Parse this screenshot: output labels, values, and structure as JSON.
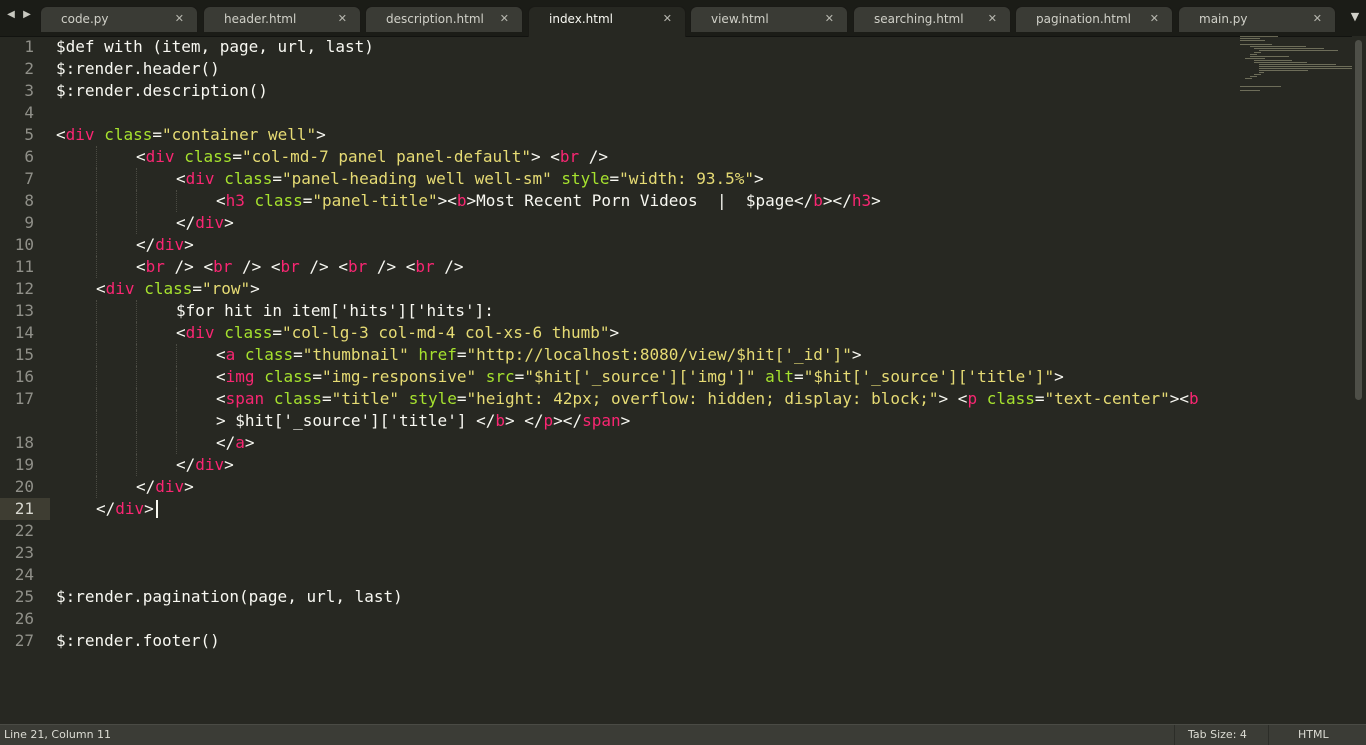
{
  "tabs": [
    {
      "label": "code.py",
      "active": false
    },
    {
      "label": "header.html",
      "active": false
    },
    {
      "label": "description.html",
      "active": false
    },
    {
      "label": "index.html",
      "active": true
    },
    {
      "label": "view.html",
      "active": false
    },
    {
      "label": "searching.html",
      "active": false
    },
    {
      "label": "pagination.html",
      "active": false
    },
    {
      "label": "main.py",
      "active": false
    }
  ],
  "icons": {
    "nav_back": "triangle-left-icon",
    "nav_forward": "triangle-right-icon",
    "tab_close": "close-icon",
    "tab_menu": "chevron-down-icon"
  },
  "editor": {
    "current_line": 21,
    "lines": [
      {
        "num": "1",
        "indent": 0,
        "tokens": [
          [
            "p",
            "$def with (item, page, url, last)"
          ]
        ]
      },
      {
        "num": "2",
        "indent": 0,
        "tokens": [
          [
            "p",
            "$:render.header()"
          ]
        ]
      },
      {
        "num": "3",
        "indent": 0,
        "tokens": [
          [
            "p",
            "$:render.description()"
          ]
        ]
      },
      {
        "num": "4",
        "indent": 0,
        "tokens": []
      },
      {
        "num": "5",
        "indent": 0,
        "tokens": [
          [
            "p",
            "<"
          ],
          [
            "t",
            "div"
          ],
          [
            "p",
            " "
          ],
          [
            "a",
            "class"
          ],
          [
            "p",
            "="
          ],
          [
            "s",
            "\"container well\""
          ],
          [
            "p",
            ">"
          ]
        ]
      },
      {
        "num": "6",
        "indent": 8,
        "tokens": [
          [
            "p",
            "<"
          ],
          [
            "t",
            "div"
          ],
          [
            "p",
            " "
          ],
          [
            "a",
            "class"
          ],
          [
            "p",
            "="
          ],
          [
            "s",
            "\"col-md-7 panel panel-default\""
          ],
          [
            "p",
            "> <"
          ],
          [
            "t",
            "br"
          ],
          [
            "p",
            " />"
          ]
        ]
      },
      {
        "num": "7",
        "indent": 12,
        "tokens": [
          [
            "p",
            "<"
          ],
          [
            "t",
            "div"
          ],
          [
            "p",
            " "
          ],
          [
            "a",
            "class"
          ],
          [
            "p",
            "="
          ],
          [
            "s",
            "\"panel-heading well well-sm\""
          ],
          [
            "p",
            " "
          ],
          [
            "a",
            "style"
          ],
          [
            "p",
            "="
          ],
          [
            "s",
            "\"width: 93.5%\""
          ],
          [
            "p",
            ">"
          ]
        ]
      },
      {
        "num": "8",
        "indent": 16,
        "tokens": [
          [
            "p",
            "<"
          ],
          [
            "t",
            "h3"
          ],
          [
            "p",
            " "
          ],
          [
            "a",
            "class"
          ],
          [
            "p",
            "="
          ],
          [
            "s",
            "\"panel-title\""
          ],
          [
            "p",
            "><"
          ],
          [
            "t",
            "b"
          ],
          [
            "p",
            ">Most Recent Porn Videos  |  $page</"
          ],
          [
            "t",
            "b"
          ],
          [
            "p",
            "></"
          ],
          [
            "t",
            "h3"
          ],
          [
            "p",
            ">"
          ]
        ]
      },
      {
        "num": "9",
        "indent": 12,
        "tokens": [
          [
            "p",
            "</"
          ],
          [
            "t",
            "div"
          ],
          [
            "p",
            ">"
          ]
        ]
      },
      {
        "num": "10",
        "indent": 8,
        "tokens": [
          [
            "p",
            "</"
          ],
          [
            "t",
            "div"
          ],
          [
            "p",
            ">"
          ]
        ]
      },
      {
        "num": "11",
        "indent": 8,
        "tokens": [
          [
            "p",
            "<"
          ],
          [
            "t",
            "br"
          ],
          [
            "p",
            " /> <"
          ],
          [
            "t",
            "br"
          ],
          [
            "p",
            " /> <"
          ],
          [
            "t",
            "br"
          ],
          [
            "p",
            " /> <"
          ],
          [
            "t",
            "br"
          ],
          [
            "p",
            " /> <"
          ],
          [
            "t",
            "br"
          ],
          [
            "p",
            " />"
          ]
        ]
      },
      {
        "num": "12",
        "indent": 4,
        "tokens": [
          [
            "p",
            "<"
          ],
          [
            "t",
            "div"
          ],
          [
            "p",
            " "
          ],
          [
            "a",
            "class"
          ],
          [
            "p",
            "="
          ],
          [
            "s",
            "\"row\""
          ],
          [
            "p",
            ">"
          ]
        ]
      },
      {
        "num": "13",
        "indent": 12,
        "tokens": [
          [
            "p",
            "$for hit in item['hits']['hits']:"
          ]
        ]
      },
      {
        "num": "14",
        "indent": 12,
        "tokens": [
          [
            "p",
            "<"
          ],
          [
            "t",
            "div"
          ],
          [
            "p",
            " "
          ],
          [
            "a",
            "class"
          ],
          [
            "p",
            "="
          ],
          [
            "s",
            "\"col-lg-3 col-md-4 col-xs-6 thumb\""
          ],
          [
            "p",
            ">"
          ]
        ]
      },
      {
        "num": "15",
        "indent": 16,
        "tokens": [
          [
            "p",
            "<"
          ],
          [
            "t",
            "a"
          ],
          [
            "p",
            " "
          ],
          [
            "a",
            "class"
          ],
          [
            "p",
            "="
          ],
          [
            "s",
            "\"thumbnail\""
          ],
          [
            "p",
            " "
          ],
          [
            "a",
            "href"
          ],
          [
            "p",
            "="
          ],
          [
            "s",
            "\"http://localhost:8080/view/$hit['_id']\""
          ],
          [
            "p",
            ">"
          ]
        ]
      },
      {
        "num": "16",
        "indent": 16,
        "tokens": [
          [
            "p",
            "<"
          ],
          [
            "t",
            "img"
          ],
          [
            "p",
            " "
          ],
          [
            "a",
            "class"
          ],
          [
            "p",
            "="
          ],
          [
            "s",
            "\"img-responsive\""
          ],
          [
            "p",
            " "
          ],
          [
            "a",
            "src"
          ],
          [
            "p",
            "="
          ],
          [
            "s",
            "\"$hit['_source']['img']\""
          ],
          [
            "p",
            " "
          ],
          [
            "a",
            "alt"
          ],
          [
            "p",
            "="
          ],
          [
            "s",
            "\"$hit['_source']['title']\""
          ],
          [
            "p",
            ">"
          ]
        ]
      },
      {
        "num": "17",
        "indent": 16,
        "tokens": [
          [
            "p",
            "<"
          ],
          [
            "t",
            "span"
          ],
          [
            "p",
            " "
          ],
          [
            "a",
            "class"
          ],
          [
            "p",
            "="
          ],
          [
            "s",
            "\"title\""
          ],
          [
            "p",
            " "
          ],
          [
            "a",
            "style"
          ],
          [
            "p",
            "="
          ],
          [
            "s",
            "\"height: 42px; overflow: hidden; display: block;\""
          ],
          [
            "p",
            "> <"
          ],
          [
            "t",
            "p"
          ],
          [
            "p",
            " "
          ],
          [
            "a",
            "class"
          ],
          [
            "p",
            "="
          ],
          [
            "s",
            "\"text-center\""
          ],
          [
            "p",
            "><"
          ],
          [
            "t",
            "b"
          ]
        ]
      },
      {
        "num": "",
        "indent": 16,
        "tokens": [
          [
            "p",
            "> $hit['_source']['title'] </"
          ],
          [
            "t",
            "b"
          ],
          [
            "p",
            "> </"
          ],
          [
            "t",
            "p"
          ],
          [
            "p",
            "></"
          ],
          [
            "t",
            "span"
          ],
          [
            "p",
            ">"
          ]
        ]
      },
      {
        "num": "18",
        "indent": 16,
        "tokens": [
          [
            "p",
            "</"
          ],
          [
            "t",
            "a"
          ],
          [
            "p",
            ">"
          ]
        ]
      },
      {
        "num": "19",
        "indent": 12,
        "tokens": [
          [
            "p",
            "</"
          ],
          [
            "t",
            "div"
          ],
          [
            "p",
            ">"
          ]
        ]
      },
      {
        "num": "20",
        "indent": 8,
        "tokens": [
          [
            "p",
            "</"
          ],
          [
            "t",
            "div"
          ],
          [
            "p",
            ">"
          ]
        ]
      },
      {
        "num": "21",
        "indent": 4,
        "tokens": [
          [
            "p",
            "</"
          ],
          [
            "t",
            "div"
          ],
          [
            "p",
            ">"
          ]
        ]
      },
      {
        "num": "22",
        "indent": 0,
        "tokens": []
      },
      {
        "num": "23",
        "indent": 0,
        "tokens": []
      },
      {
        "num": "24",
        "indent": 0,
        "tokens": []
      },
      {
        "num": "25",
        "indent": 0,
        "tokens": [
          [
            "p",
            "$:render.pagination(page, url, last)"
          ]
        ]
      },
      {
        "num": "26",
        "indent": 0,
        "tokens": []
      },
      {
        "num": "27",
        "indent": 0,
        "tokens": [
          [
            "p",
            "$:render.footer()"
          ]
        ]
      }
    ]
  },
  "status": {
    "position": "Line 21, Column 11",
    "tab_size": "Tab Size: 4",
    "syntax": "HTML"
  }
}
